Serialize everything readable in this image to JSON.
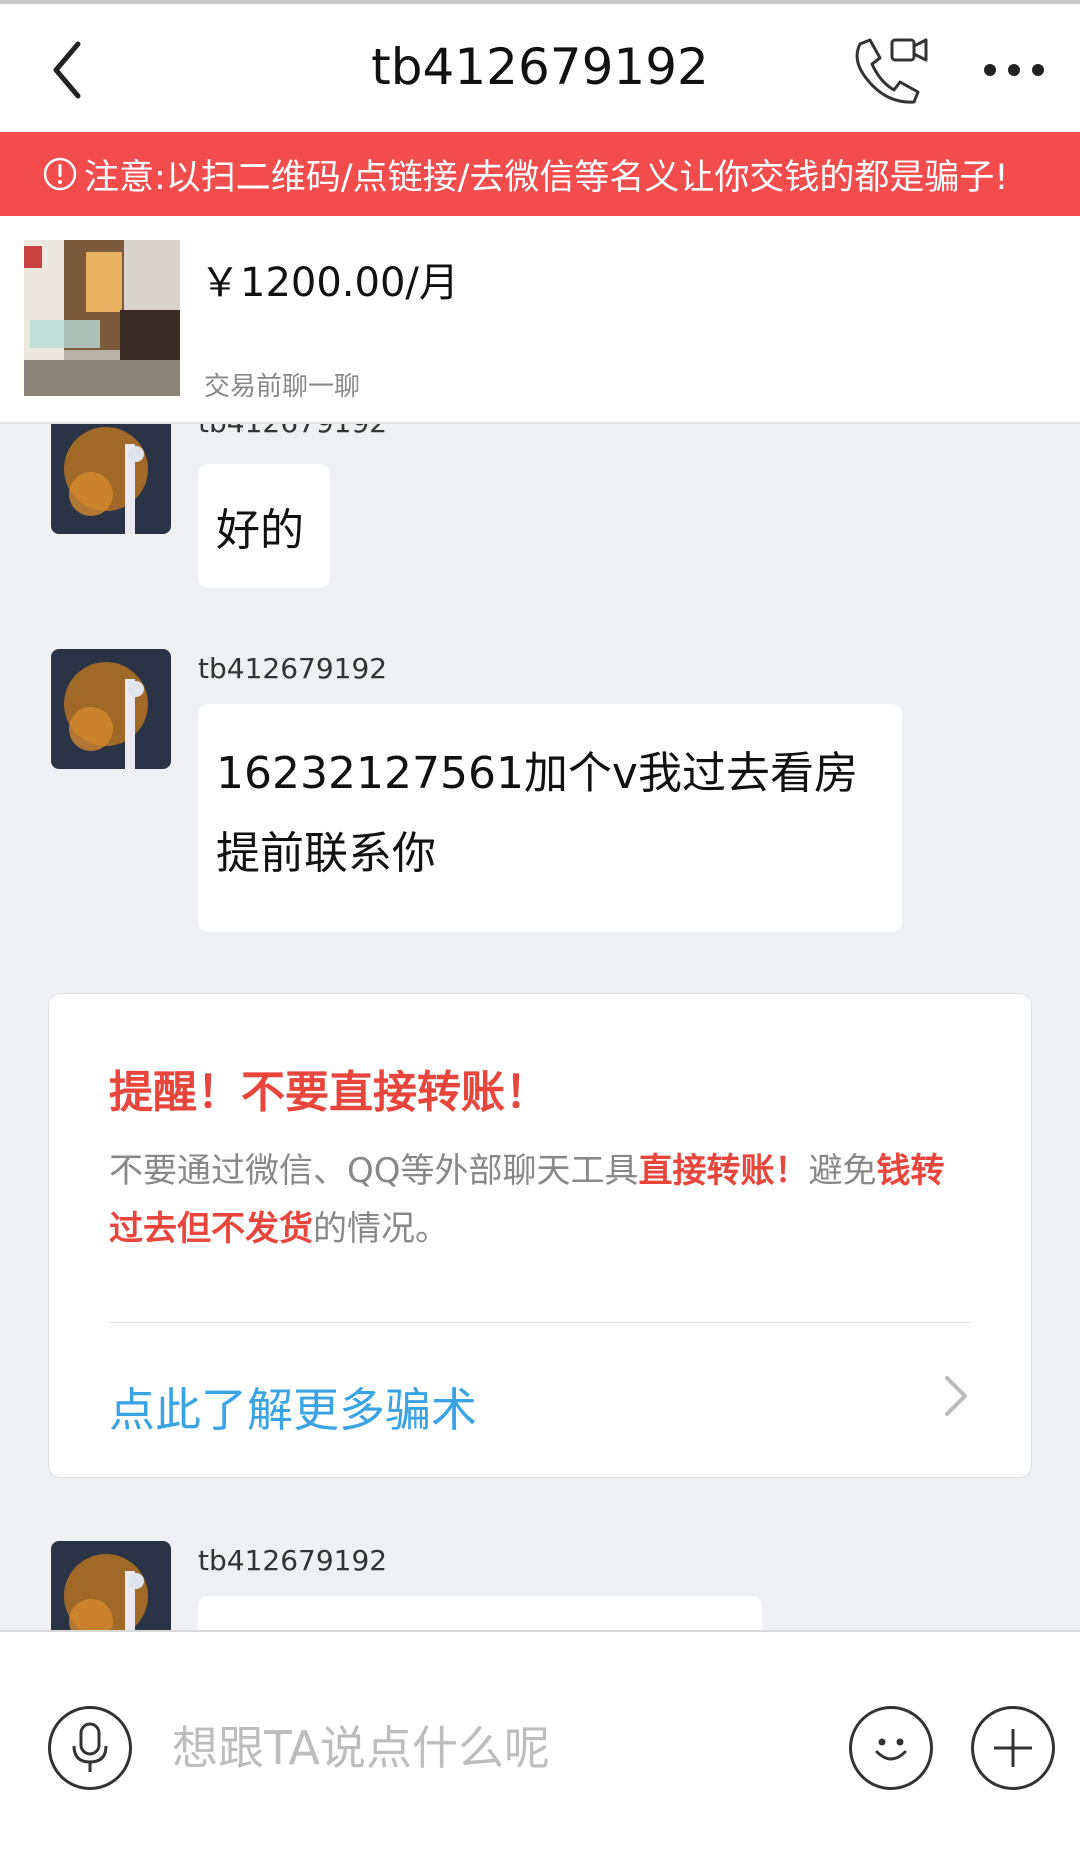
{
  "header": {
    "title": "tb412679192"
  },
  "warning": {
    "text": "注意:以扫二维码/点链接/去微信等名义让你交钱的都是骗子!"
  },
  "product": {
    "price": "￥1200.00/月",
    "subtitle": "交易前聊一聊"
  },
  "messages": [
    {
      "sender": "tb412679192",
      "text": "好的"
    },
    {
      "sender": "tb412679192",
      "text_line1": "16232127561加个v我过去看房",
      "text_line2": "提前联系你"
    },
    {
      "sender": "tb412679192",
      "text": ""
    }
  ],
  "reminder": {
    "title": "提醒！不要直接转账！",
    "body_part1": "不要通过微信、QQ等外部聊天工具",
    "body_highlight1": "直接转账！",
    "body_part2": "避免",
    "body_highlight2": "钱转过去但不发货",
    "body_part3": "的情况。",
    "link": "点此了解更多骗术"
  },
  "input": {
    "placeholder": "想跟TA说点什么呢"
  },
  "colors": {
    "warning_bg": "#f24c4c",
    "alert_red": "#e8453c",
    "link_blue": "#3aa3e3"
  },
  "icons": [
    "back-icon",
    "video-call-icon",
    "more-icon",
    "alert-icon",
    "chevron-right-icon",
    "microphone-icon",
    "emoji-icon",
    "plus-icon"
  ]
}
